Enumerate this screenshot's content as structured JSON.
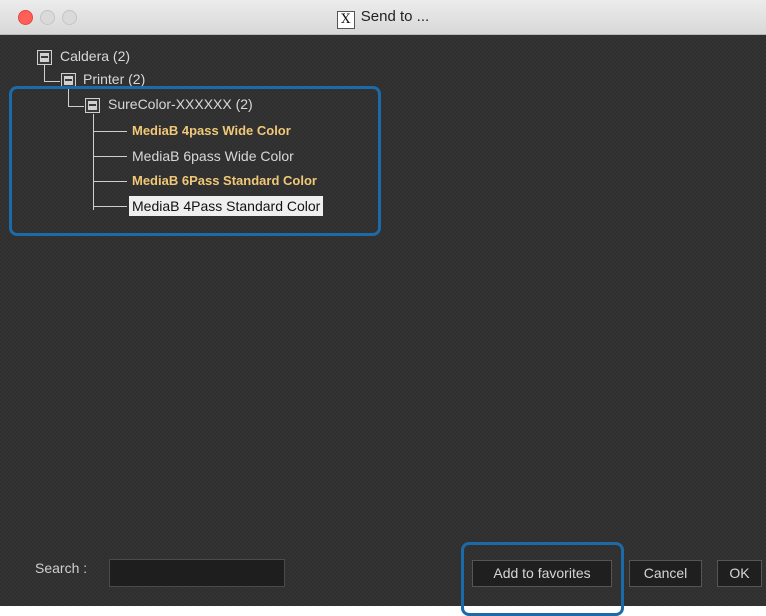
{
  "window": {
    "title": "Send to ...",
    "app_icon_glyph": "X"
  },
  "tree": {
    "root": {
      "label": "Caldera (2)"
    },
    "printer": {
      "label": "Printer (2)"
    },
    "device": {
      "label": "SureColor-XXXXXX (2)"
    },
    "media": [
      {
        "label": "MediaB 4pass Wide Color",
        "style": "bold"
      },
      {
        "label": "MediaB 6pass Wide Color",
        "style": "normal"
      },
      {
        "label": "MediaB 6Pass Standard Color",
        "style": "bold"
      },
      {
        "label": "MediaB 4Pass Standard Color",
        "style": "selected"
      }
    ]
  },
  "footer": {
    "search_label": "Search :",
    "search_value": "",
    "add_favorites_label": "Add to favorites",
    "cancel_label": "Cancel",
    "ok_label": "OK"
  },
  "colors": {
    "highlight": "#1c6aa8",
    "bold_item": "#f0c878",
    "close": "#ff5f57"
  }
}
